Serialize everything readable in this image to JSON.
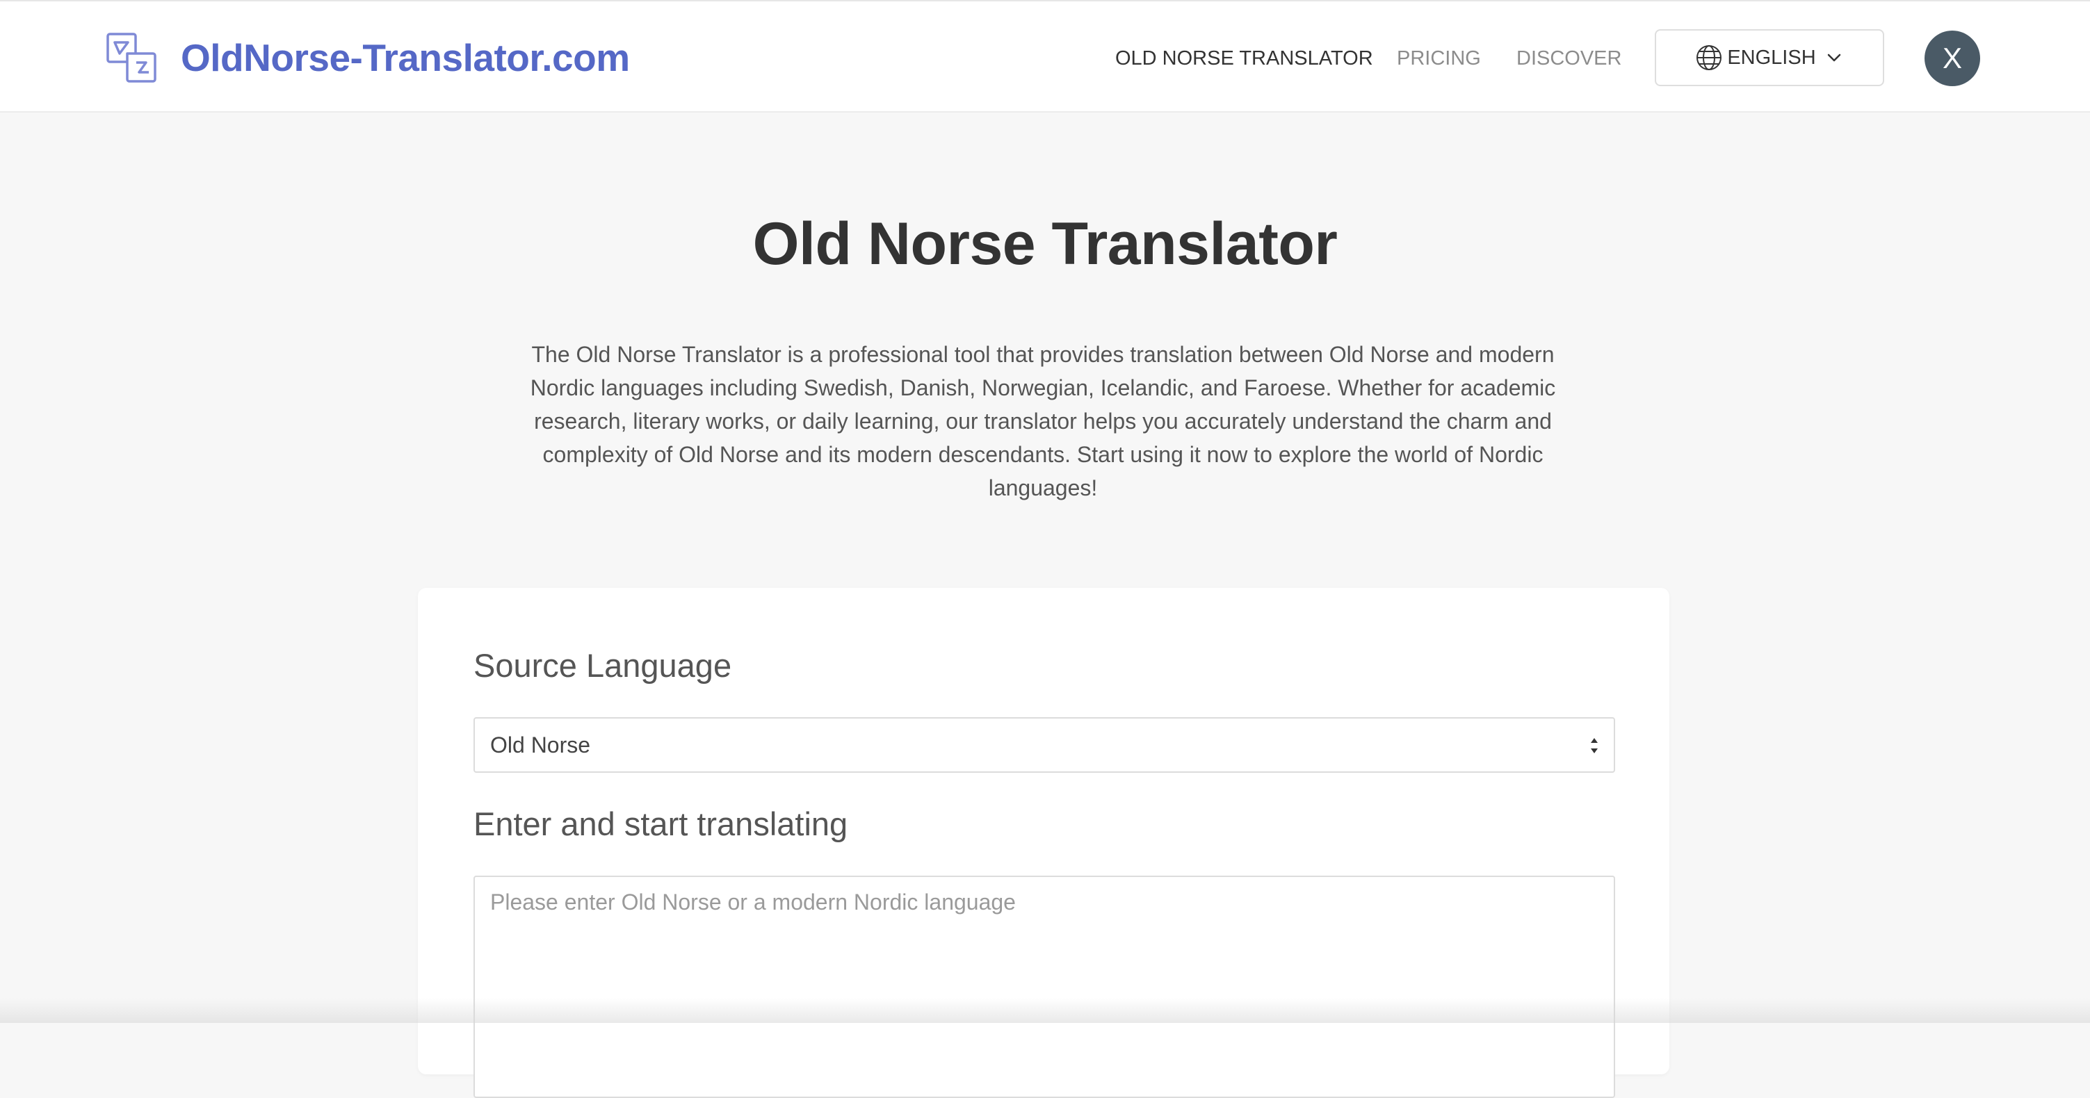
{
  "header": {
    "brand_name": "OldNorse-Translator.com",
    "nav": [
      {
        "label": "OLD NORSE TRANSLATOR",
        "active": true
      },
      {
        "label": "PRICING",
        "active": false
      },
      {
        "label": "DISCOVER",
        "active": false
      }
    ],
    "language_button_label": "ENGLISH",
    "close_label": "X"
  },
  "hero": {
    "title": "Old Norse Translator",
    "description": "The Old Norse Translator is a professional tool that provides translation between Old Norse and modern Nordic languages including Swedish, Danish, Norwegian, Icelandic, and Faroese. Whether for academic research, literary works, or daily learning, our translator helps you accurately understand the charm and complexity of Old Norse and its modern descendants. Start using it now to explore the world of Nordic languages!"
  },
  "translator": {
    "source_language_label": "Source Language",
    "source_language_value": "Old Norse",
    "input_label": "Enter and start translating",
    "input_placeholder": "Please enter Old Norse or a modern Nordic language",
    "input_value": ""
  },
  "colors": {
    "brand": "#5568c6",
    "page_background": "#f7f7f7",
    "close_button": "#4a5a66"
  },
  "icons": {
    "logo": "translate-icon",
    "language": "globe-icon",
    "dropdown": "chevron-down-icon",
    "select": "updown-arrows-icon"
  }
}
